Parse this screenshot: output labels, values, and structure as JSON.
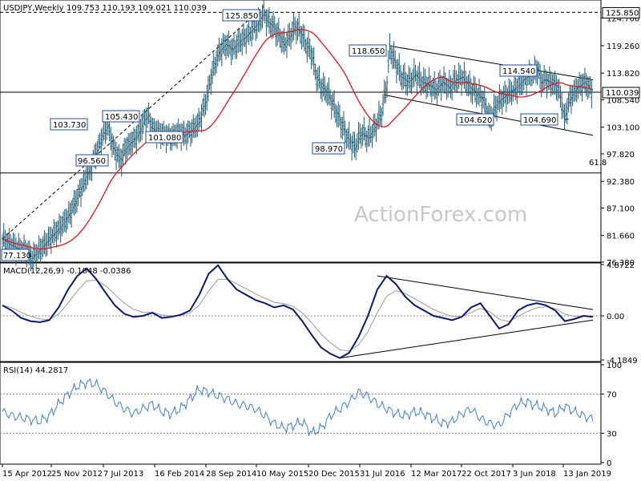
{
  "header": {
    "symbol": "USDJPY,Weekly",
    "ohlc": "109.753 110.193 109.021 110.039",
    "watermark": "ActionForex.com"
  },
  "colors": {
    "price": "#1f5c73",
    "ma": "#e8141e",
    "macd": "#0b1a6e",
    "signal": "#9a9a9a",
    "rsi": "#3f7fd6",
    "box_border": "#1f4fa0"
  },
  "chart_data": [
    {
      "type": "candlestick",
      "panel": "price",
      "title": "USDJPY,Weekly",
      "ylim": [
        76.38,
        128.3
      ],
      "y_ticks": [
        "124.700",
        "119.260",
        "113.820",
        "108.540",
        "103.100",
        "97.820",
        "92.380",
        "87.100",
        "81.660",
        "76.380"
      ],
      "x_ticks": [
        "15 Apr 2012",
        "25 Nov 2012",
        "7 Jul 2013",
        "16 Feb 2014",
        "28 Sep 2014",
        "10 May 2015",
        "20 Dec 2015",
        "31 Jul 2016",
        "12 Mar 2017",
        "22 Oct 2017",
        "3 Jun 2018",
        "13 Jan 2019"
      ],
      "current_price_label": "110.039",
      "top_label": "125.850",
      "fib_label": "61.8",
      "hlines": [
        125.85,
        110.039,
        94.05
      ],
      "series_path_points": [
        [
          0,
          81.0
        ],
        [
          5,
          80.0
        ],
        [
          10,
          79.2
        ],
        [
          15,
          78.8
        ],
        [
          18,
          78.5
        ],
        [
          22,
          77.2
        ],
        [
          25,
          78.0
        ],
        [
          30,
          79.5
        ],
        [
          35,
          81.0
        ],
        [
          40,
          82.5
        ],
        [
          45,
          84.0
        ],
        [
          50,
          86.0
        ],
        [
          55,
          89.0
        ],
        [
          60,
          92.0
        ],
        [
          65,
          95.0
        ],
        [
          70,
          98.5
        ],
        [
          75,
          102.0
        ],
        [
          78,
          103.5
        ],
        [
          80,
          101.0
        ],
        [
          82,
          99.0
        ],
        [
          85,
          97.5
        ],
        [
          88,
          96.6
        ],
        [
          90,
          98.5
        ],
        [
          95,
          100.0
        ],
        [
          100,
          101.5
        ],
        [
          105,
          104.5
        ],
        [
          108,
          105.4
        ],
        [
          110,
          103.0
        ],
        [
          115,
          102.0
        ],
        [
          120,
          101.5
        ],
        [
          125,
          101.1
        ],
        [
          130,
          102.0
        ],
        [
          135,
          101.5
        ],
        [
          140,
          102.5
        ],
        [
          145,
          104.0
        ],
        [
          150,
          108.0
        ],
        [
          155,
          114.0
        ],
        [
          160,
          118.0
        ],
        [
          165,
          119.5
        ],
        [
          170,
          118.5
        ],
        [
          175,
          120.0
        ],
        [
          180,
          121.0
        ],
        [
          185,
          122.5
        ],
        [
          190,
          124.0
        ],
        [
          193,
          125.85
        ],
        [
          196,
          124.0
        ],
        [
          200,
          123.0
        ],
        [
          205,
          121.0
        ],
        [
          208,
          119.5
        ],
        [
          212,
          121.0
        ],
        [
          216,
          123.0
        ],
        [
          220,
          122.0
        ],
        [
          225,
          119.0
        ],
        [
          228,
          118.0
        ],
        [
          232,
          113.0
        ],
        [
          236,
          111.0
        ],
        [
          240,
          110.0
        ],
        [
          245,
          107.0
        ],
        [
          250,
          104.0
        ],
        [
          255,
          101.0
        ],
        [
          258,
          100.0
        ],
        [
          260,
          98.97
        ],
        [
          265,
          102.0
        ],
        [
          270,
          101.0
        ],
        [
          275,
          103.0
        ],
        [
          280,
          106.0
        ],
        [
          284,
          112.0
        ],
        [
          286,
          118.65
        ],
        [
          290,
          116.0
        ],
        [
          295,
          113.0
        ],
        [
          300,
          112.0
        ],
        [
          305,
          113.5
        ],
        [
          310,
          112.0
        ],
        [
          315,
          111.5
        ],
        [
          320,
          110.5
        ],
        [
          325,
          112.0
        ],
        [
          330,
          111.0
        ],
        [
          335,
          112.5
        ],
        [
          340,
          113.0
        ],
        [
          345,
          111.0
        ],
        [
          350,
          110.0
        ],
        [
          355,
          108.5
        ],
        [
          358,
          106.0
        ],
        [
          360,
          104.62
        ],
        [
          363,
          106.5
        ],
        [
          366,
          108.0
        ],
        [
          370,
          109.0
        ],
        [
          375,
          110.0
        ],
        [
          380,
          111.0
        ],
        [
          385,
          112.5
        ],
        [
          390,
          113.5
        ],
        [
          395,
          114.54
        ],
        [
          398,
          112.0
        ],
        [
          400,
          112.5
        ],
        [
          405,
          112.0
        ],
        [
          410,
          111.0
        ],
        [
          413,
          108.0
        ],
        [
          415,
          104.69
        ],
        [
          418,
          108.0
        ],
        [
          422,
          110.0
        ],
        [
          425,
          111.0
        ],
        [
          430,
          112.0
        ],
        [
          433,
          111.0
        ],
        [
          436,
          110.04
        ]
      ]
    },
    {
      "type": "line",
      "panel": "macd",
      "title": "MACD(12,26,9) -0.1048 -0.0386",
      "ylim": [
        -4.1849,
        4.8722
      ],
      "y_ticks": [
        "4.8722",
        "0.00",
        "-4.1849"
      ],
      "series": [
        {
          "name": "MACD",
          "values": [
            1.0,
            0.5,
            -0.2,
            -0.5,
            -0.6,
            -0.4,
            0.8,
            2.5,
            3.8,
            4.5,
            3.5,
            2.2,
            1.0,
            0.2,
            -0.1,
            0.0,
            0.3,
            -0.2,
            -0.1,
            0.1,
            0.5,
            2.0,
            4.0,
            4.8,
            3.5,
            2.5,
            2.0,
            1.5,
            1.2,
            0.8,
            1.0,
            0.6,
            -0.5,
            -1.8,
            -3.0,
            -3.6,
            -4.0,
            -3.5,
            -2.0,
            0.0,
            2.5,
            3.8,
            3.0,
            1.8,
            1.0,
            0.5,
            0.0,
            -0.2,
            -0.4,
            -0.1,
            0.8,
            1.2,
            0.0,
            -1.2,
            -0.8,
            0.5,
            1.0,
            1.2,
            1.0,
            0.5,
            -0.5,
            -0.3,
            0.0,
            -0.1
          ]
        }
      ]
    },
    {
      "type": "line",
      "panel": "rsi",
      "title": "RSI(14) 44.2817",
      "ylim": [
        0,
        100
      ],
      "y_ticks": [
        "100",
        "70",
        "30",
        "0"
      ],
      "series": [
        {
          "name": "RSI",
          "values": [
            52,
            48,
            46,
            44,
            42,
            48,
            60,
            70,
            78,
            82,
            80,
            72,
            62,
            55,
            50,
            55,
            60,
            52,
            50,
            55,
            65,
            75,
            72,
            68,
            65,
            60,
            58,
            55,
            48,
            40,
            35,
            38,
            42,
            30,
            35,
            48,
            55,
            62,
            72,
            68,
            60,
            55,
            50,
            48,
            52,
            50,
            45,
            40,
            42,
            50,
            55,
            45,
            40,
            38,
            50,
            60,
            62,
            58,
            55,
            50,
            58,
            52,
            48,
            44
          ]
        }
      ]
    }
  ],
  "annotations": {
    "boxes": [
      "125.850",
      "118.650",
      "114.540",
      "105.430",
      "103.730",
      "101.080",
      "96.560",
      "104.620",
      "104.690",
      "98.970",
      "77.130"
    ]
  }
}
